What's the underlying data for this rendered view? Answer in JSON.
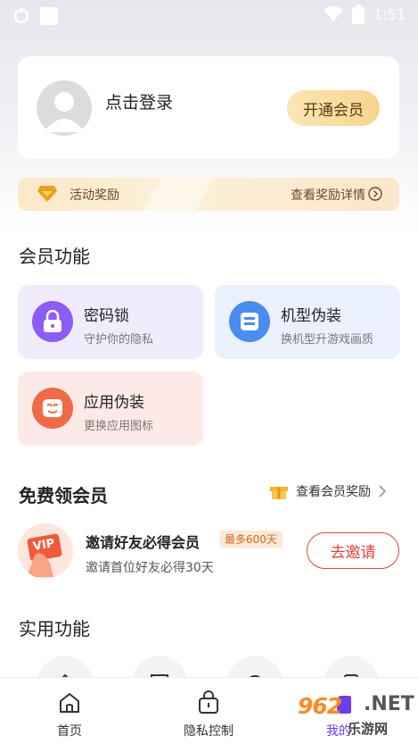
{
  "status_bar": {
    "time": "1:51"
  },
  "user": {
    "login_prompt": "点击登录",
    "vip_button": "开通会员"
  },
  "reward_bar": {
    "label": "活动奖励",
    "link": "查看奖励详情"
  },
  "member_features": {
    "title": "会员功能",
    "items": [
      {
        "title": "密码锁",
        "subtitle": "守护你的隐私",
        "icon": "lock-icon",
        "color": "#8b5cf6"
      },
      {
        "title": "机型伪装",
        "subtitle": "换机型升游戏画质",
        "icon": "device-disguise-icon",
        "color": "#4a8cf0"
      },
      {
        "title": "应用伪装",
        "subtitle": "更换应用图标",
        "icon": "app-mask-icon",
        "color": "#f06a4a"
      }
    ]
  },
  "free_vip": {
    "title": "免费领会员",
    "link": "查看会员奖励",
    "invite": {
      "badge": "VIP",
      "title": "邀请好友必得会员",
      "tag": "最多600天",
      "subtitle": "邀请首位好友必得30天",
      "button": "去邀请"
    }
  },
  "utilities": {
    "title": "实用功能"
  },
  "tab_bar": {
    "tabs": [
      {
        "label": "首页",
        "icon": "home-icon"
      },
      {
        "label": "隐私控制",
        "icon": "lock-bag-icon"
      }
    ],
    "partial_label": "我的"
  },
  "watermark": {
    "logo": "962",
    "net": ".NET",
    "site": "乐游网"
  }
}
